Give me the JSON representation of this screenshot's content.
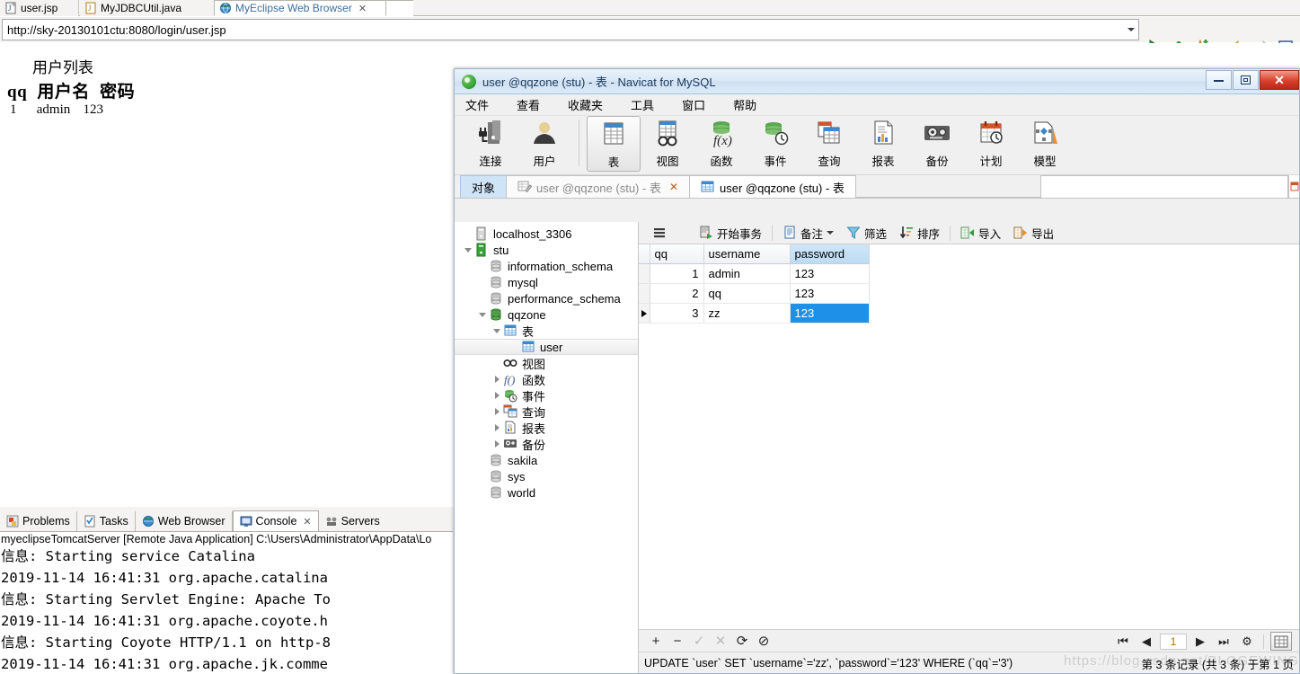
{
  "eclipse": {
    "editor_tabs": [
      {
        "label": "user.jsp",
        "icon": "jsp-file-icon",
        "active": false,
        "closable": false
      },
      {
        "label": "MyJDBCUtil.java",
        "icon": "java-file-icon",
        "active": false,
        "closable": false
      },
      {
        "label": "MyEclipse Web Browser",
        "icon": "globe-icon",
        "active": true,
        "closable": true
      }
    ],
    "address_bar": {
      "url": "http://sky-20130101ctu:8080/login/user.jsp",
      "placeholder": "",
      "dropdown_icon": "chevron-down-icon"
    },
    "browser_buttons": [
      {
        "name": "run-icon",
        "glyph": "▶"
      },
      {
        "name": "debug-icon",
        "glyph": "bug"
      },
      {
        "name": "favorites-icon",
        "glyph": "★"
      },
      {
        "name": "favorites-dropdown-icon",
        "glyph": "▾"
      },
      {
        "name": "back-icon",
        "glyph": "⇦"
      },
      {
        "name": "forward-icon",
        "glyph": "⇨"
      },
      {
        "name": "stop-icon",
        "glyph": "■"
      }
    ],
    "web_page": {
      "title": "用户列表",
      "headers": [
        "qq",
        "用户名",
        "密码"
      ],
      "rows": [
        {
          "qq": "1",
          "username": "admin",
          "password": "123"
        }
      ]
    },
    "bottom_tabs": [
      {
        "label": "Problems",
        "icon": "problems-icon",
        "active": false
      },
      {
        "label": "Tasks",
        "icon": "tasks-icon",
        "active": false
      },
      {
        "label": "Web Browser",
        "icon": "globe-icon",
        "active": false
      },
      {
        "label": "Console",
        "icon": "console-icon",
        "active": true,
        "closable": true
      },
      {
        "label": "Servers",
        "icon": "servers-icon",
        "active": false
      }
    ],
    "console": {
      "header": "myeclipseTomcatServer [Remote Java Application] C:\\Users\\Administrator\\AppData\\Lo",
      "lines": [
        "信息: Starting service Catalina",
        "2019-11-14 16:41:31 org.apache.catalina",
        "信息: Starting Servlet Engine: Apache To",
        "2019-11-14 16:41:31 org.apache.coyote.h",
        "信息: Starting Coyote HTTP/1.1 on http-8",
        "2019-11-14 16:41:31 org.apache.jk.comme"
      ]
    }
  },
  "navicat": {
    "title": "user @qqzone (stu) - 表 - Navicat for MySQL",
    "logo_icon": "navicat-logo-icon",
    "window_buttons": [
      {
        "name": "minimize-button",
        "icon": "minimize-icon"
      },
      {
        "name": "restore-button",
        "icon": "restore-icon"
      },
      {
        "name": "close-button",
        "icon": "close-icon",
        "label": "✕"
      }
    ],
    "menu": [
      "文件",
      "查看",
      "收藏夹",
      "工具",
      "窗口",
      "帮助"
    ],
    "toolbar": [
      {
        "label": "连接",
        "icon": "connection-icon",
        "selected": false
      },
      {
        "label": "用户",
        "icon": "user-icon",
        "selected": false
      },
      {
        "label": "表",
        "icon": "table-icon",
        "selected": true
      },
      {
        "label": "视图",
        "icon": "view-icon",
        "selected": false
      },
      {
        "label": "函数",
        "icon": "function-icon",
        "selected": false
      },
      {
        "label": "事件",
        "icon": "event-icon",
        "selected": false
      },
      {
        "label": "查询",
        "icon": "query-icon",
        "selected": false
      },
      {
        "label": "报表",
        "icon": "report-icon",
        "selected": false
      },
      {
        "label": "备份",
        "icon": "backup-icon",
        "selected": false
      },
      {
        "label": "计划",
        "icon": "schedule-icon",
        "selected": false
      },
      {
        "label": "模型",
        "icon": "model-icon",
        "selected": false
      }
    ],
    "tabs": [
      {
        "label": "对象",
        "icon": "",
        "state": "object"
      },
      {
        "label": "user @qqzone (stu) - 表",
        "icon": "designer-icon",
        "state": "inactive",
        "closable": true
      },
      {
        "label": "user @qqzone (stu) - 表",
        "icon": "table-icon",
        "state": "active"
      }
    ],
    "tree": [
      {
        "label": "localhost_3306",
        "icon": "server-icon",
        "indent": 1,
        "twisty": "",
        "selected": false
      },
      {
        "label": "stu",
        "icon": "server-green-icon",
        "indent": 1,
        "twisty": "down",
        "selected": false
      },
      {
        "label": "information_schema",
        "icon": "database-icon",
        "indent": 2,
        "twisty": "",
        "selected": false
      },
      {
        "label": "mysql",
        "icon": "database-icon",
        "indent": 2,
        "twisty": "",
        "selected": false
      },
      {
        "label": "performance_schema",
        "icon": "database-icon",
        "indent": 2,
        "twisty": "",
        "selected": false
      },
      {
        "label": "qqzone",
        "icon": "database-open-icon",
        "indent": 2,
        "twisty": "down",
        "selected": false
      },
      {
        "label": "表",
        "icon": "table-icon",
        "indent": 3,
        "twisty": "down",
        "selected": false
      },
      {
        "label": "user",
        "icon": "table-icon",
        "indent": 4,
        "twisty": "",
        "selected": true
      },
      {
        "label": "视图",
        "icon": "view-icon",
        "indent": 3,
        "twisty": "",
        "selected": false
      },
      {
        "label": "函数",
        "icon": "function-icon",
        "indent": 3,
        "twisty": "right",
        "selected": false
      },
      {
        "label": "事件",
        "icon": "event-icon",
        "indent": 3,
        "twisty": "right",
        "selected": false
      },
      {
        "label": "查询",
        "icon": "query-icon",
        "indent": 3,
        "twisty": "right",
        "selected": false
      },
      {
        "label": "报表",
        "icon": "report-icon",
        "indent": 3,
        "twisty": "right",
        "selected": false
      },
      {
        "label": "备份",
        "icon": "backup-icon",
        "indent": 3,
        "twisty": "right",
        "selected": false
      },
      {
        "label": "sakila",
        "icon": "database-icon",
        "indent": 2,
        "twisty": "",
        "selected": false
      },
      {
        "label": "sys",
        "icon": "database-icon",
        "indent": 2,
        "twisty": "",
        "selected": false
      },
      {
        "label": "world",
        "icon": "database-icon",
        "indent": 2,
        "twisty": "",
        "selected": false
      }
    ],
    "grid_toolbar": [
      {
        "label": "",
        "icon": "hamburger-menu-icon",
        "name": "grid-menu-button"
      },
      {
        "label": "开始事务",
        "icon": "begin-transaction-icon",
        "name": "begin-transaction-button"
      },
      {
        "label": "备注",
        "icon": "note-icon",
        "name": "note-button",
        "dropdown": true
      },
      {
        "label": "筛选",
        "icon": "filter-icon",
        "name": "filter-button"
      },
      {
        "label": "排序",
        "icon": "sort-icon",
        "name": "sort-button"
      },
      {
        "label": "导入",
        "icon": "import-icon",
        "name": "import-button"
      },
      {
        "label": "导出",
        "icon": "export-icon",
        "name": "export-button"
      }
    ],
    "grid": {
      "columns": [
        "qq",
        "username",
        "password"
      ],
      "highlighted_column": "password",
      "rows": [
        {
          "qq": "1",
          "username": "admin",
          "password": "123",
          "current": false,
          "selected_cell": false
        },
        {
          "qq": "2",
          "username": "qq",
          "password": "123",
          "current": false,
          "selected_cell": false
        },
        {
          "qq": "3",
          "username": "zz",
          "password": "123",
          "current": true,
          "selected_cell": true
        }
      ]
    },
    "record_buttons": [
      {
        "name": "add-record-button",
        "glyph": "+",
        "enabled": true
      },
      {
        "name": "delete-record-button",
        "glyph": "−",
        "enabled": true
      },
      {
        "name": "apply-change-button",
        "glyph": "✓",
        "enabled": false
      },
      {
        "name": "cancel-change-button",
        "glyph": "✕",
        "enabled": false
      },
      {
        "name": "refresh-button",
        "glyph": "⟳",
        "enabled": true
      },
      {
        "name": "stop-button",
        "glyph": "⊘",
        "enabled": true
      }
    ],
    "pager": {
      "first": "⏮",
      "prev": "◀",
      "page": "1",
      "next": "▶",
      "last": "⏭",
      "settings_icon": "gear-icon",
      "view_icon": "grid-view-icon"
    },
    "sql_preview": "UPDATE `user` SET `username`='zz', `password`='123' WHERE (`qq`='3')",
    "record_status": "第 3 条记录 (共 3 条) 于第 1 页",
    "watermark": "https://blog.csdn.net/BLOGEWING"
  },
  "colors": {
    "selection_blue": "#1e90e8",
    "header_highlight": "#bcdcf4",
    "title_blue": "#1b3a5c",
    "tab_active_blue": "#cfe4f7"
  }
}
